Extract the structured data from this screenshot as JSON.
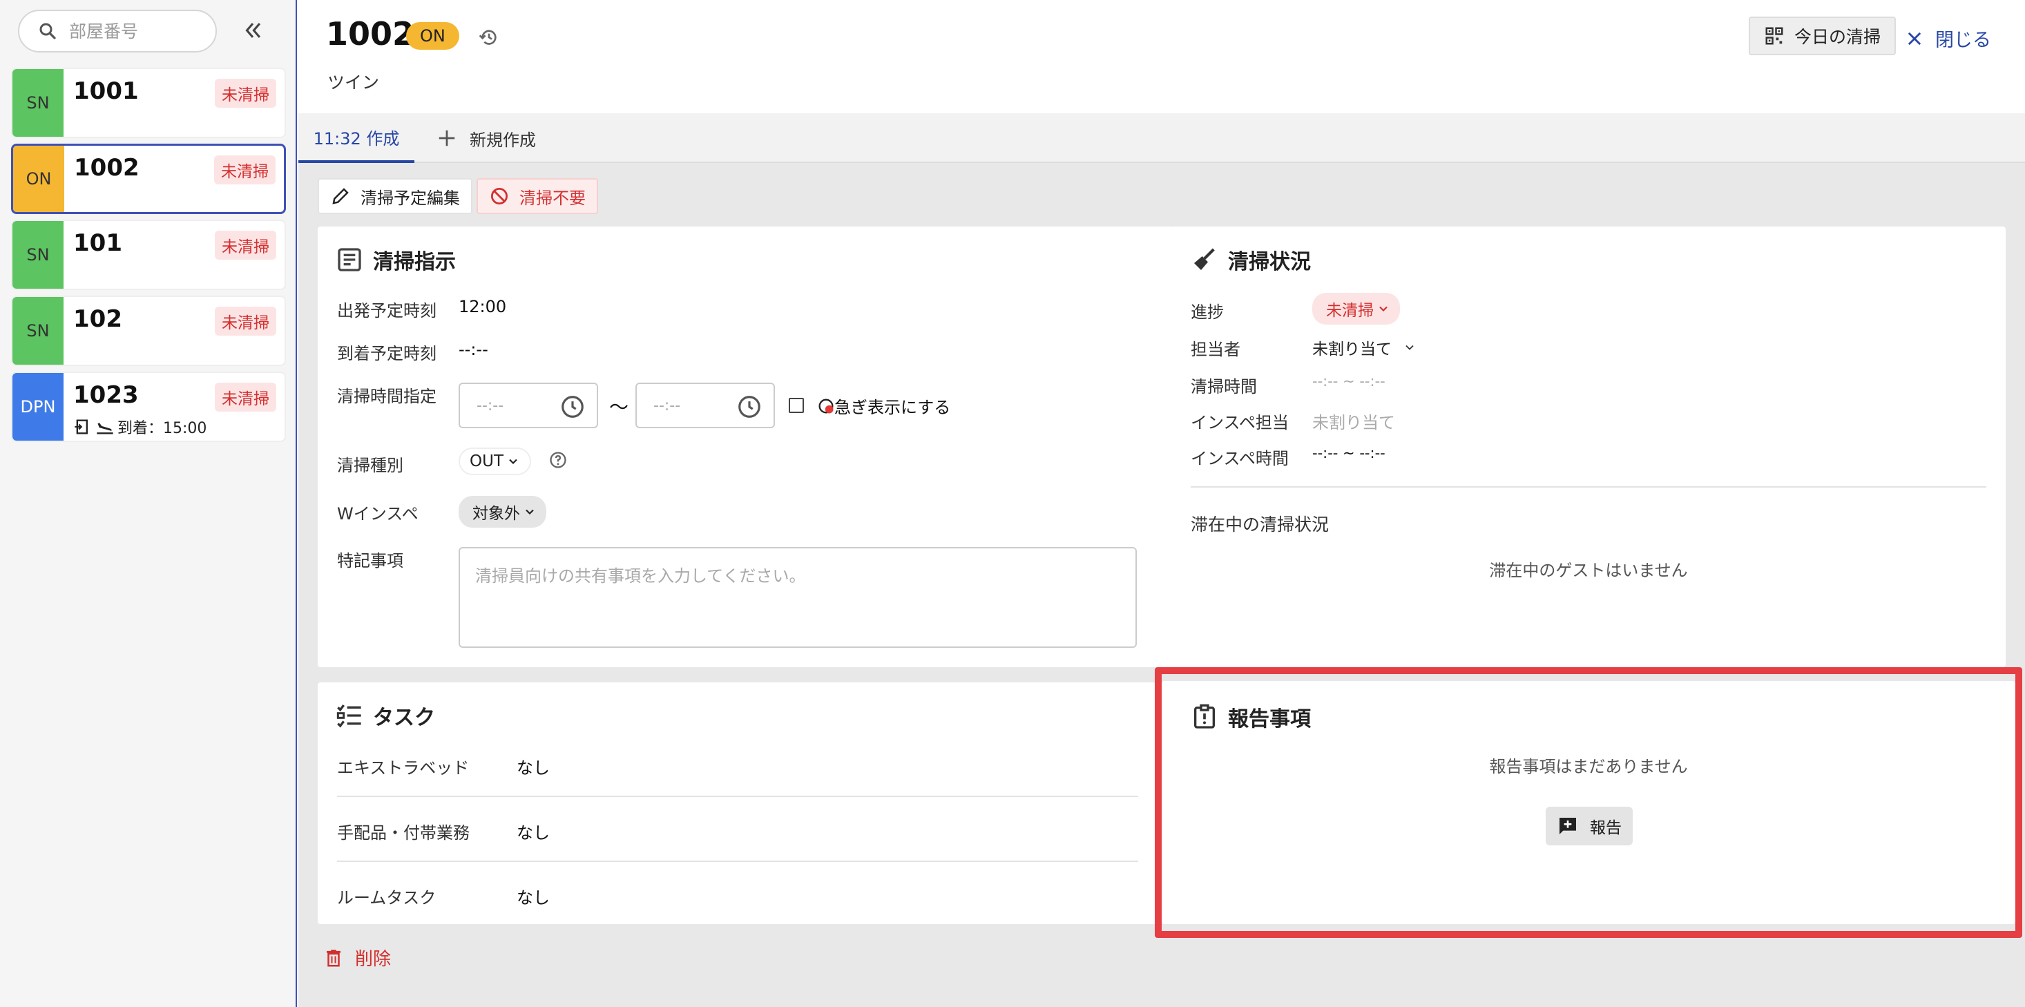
{
  "sidebar": {
    "search": {
      "placeholder": "部屋番号",
      "icon": "search-icon"
    },
    "collapse_icon": "double-chevron-left-icon",
    "rooms": [
      {
        "status": "SN",
        "status_color": "#5cc460",
        "number": "1001",
        "badge": "未清掃"
      },
      {
        "status": "ON",
        "status_color": "#f5b731",
        "number": "1002",
        "badge": "未清掃",
        "selected": true
      },
      {
        "status": "SN",
        "status_color": "#5cc460",
        "number": "101",
        "badge": "未清掃"
      },
      {
        "status": "SN",
        "status_color": "#5cc460",
        "number": "102",
        "badge": "未清掃"
      },
      {
        "status": "DPN",
        "status_color": "#3f7be8",
        "number": "1023",
        "badge": "未清掃",
        "arrival": "到着：15:00"
      }
    ]
  },
  "header": {
    "room_number": "1002",
    "status_pill": "ON",
    "room_type": "ツイン",
    "today_button": "今日の清掃",
    "close_button": "閉じる"
  },
  "tabs": {
    "active": "11:32 作成",
    "new": "新規作成"
  },
  "actions": {
    "edit": "清掃予定編集",
    "no_cleaning": "清掃不要"
  },
  "instructions": {
    "title": "清掃指示",
    "departure_label": "出発予定時刻",
    "departure_value": "12:00",
    "arrival_label": "到着予定時刻",
    "arrival_value": "--:--",
    "time_spec_label": "清掃時間指定",
    "time_from_placeholder": "--:--",
    "time_sep": "〜",
    "time_to_placeholder": "--:--",
    "urgent_label": "急ぎ表示にする",
    "type_label": "清掃種別",
    "type_value": "OUT",
    "winspect_label": "Wインスペ",
    "winspect_value": "対象外",
    "notes_label": "特記事項",
    "notes_placeholder": "清掃員向けの共有事項を入力してください。"
  },
  "status": {
    "title": "清掃状況",
    "progress_label": "進捗",
    "progress_value": "未清掃",
    "assignee_label": "担当者",
    "assignee_value": "未割り当て",
    "clean_time_label": "清掃時間",
    "clean_time_value": "--:-- ~ --:--",
    "inspect_assignee_label": "インスペ担当",
    "inspect_assignee_value": "未割り当て",
    "inspect_time_label": "インスペ時間",
    "inspect_time_value": "--:-- ~ --:--",
    "stay_title": "滞在中の清掃状況",
    "stay_empty": "滞在中のゲストはいません"
  },
  "tasks": {
    "title": "タスク",
    "rows": [
      {
        "label": "エキストラベッド",
        "value": "なし"
      },
      {
        "label": "手配品・付帯業務",
        "value": "なし"
      },
      {
        "label": "ルームタスク",
        "value": "なし"
      }
    ]
  },
  "report": {
    "title": "報告事項",
    "empty": "報告事項はまだありません",
    "button": "報告"
  },
  "delete_button": "削除",
  "colors": {
    "accent": "#2747a5",
    "danger": "#d32f2f",
    "on_status": "#f5b731",
    "sn_status": "#5cc460",
    "dpn_status": "#3f7be8",
    "highlight": "#e53e43"
  }
}
